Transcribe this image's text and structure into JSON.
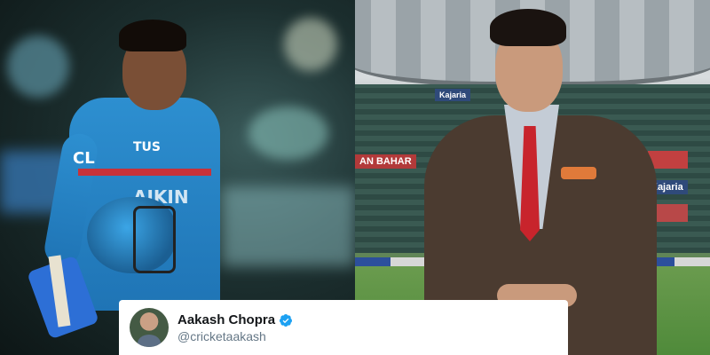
{
  "left_photo": {
    "jersey_texts": [
      "CL",
      "TUS",
      "AIKIN"
    ]
  },
  "right_photo": {
    "stadium_banners": [
      "Kajaria",
      "AN BAHAR",
      "Kajaria"
    ]
  },
  "tweet_card": {
    "display_name": "Aakash Chopra",
    "handle": "@cricketaakash",
    "verified_color": "#1da1f2"
  }
}
